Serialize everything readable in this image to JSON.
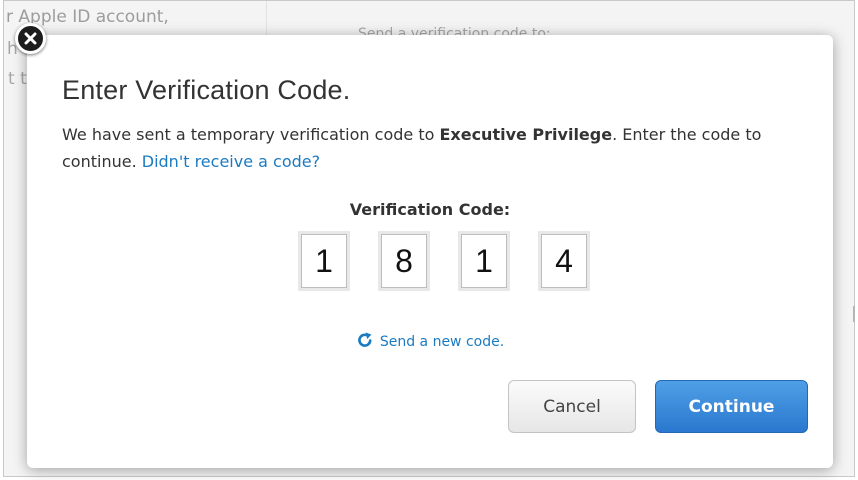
{
  "background": {
    "left_text": "r Apple ID account,",
    "fragment_1": "h",
    "fragment_2": "t t",
    "right_text": "Send a verification code to:"
  },
  "icons": {
    "close": "close-icon",
    "refresh": "refresh-icon"
  },
  "modal": {
    "title": "Enter Verification Code.",
    "message_prefix": "We have sent a temporary verification code to ",
    "message_recipient": "Executive Privilege",
    "message_suffix": ". Enter the code to continue. ",
    "didnt_receive_link": "Didn't receive a code?",
    "code_label": "Verification Code:",
    "code_digits": [
      "1",
      "8",
      "1",
      "4"
    ],
    "send_new_code": "Send a new code.",
    "cancel_label": "Cancel",
    "continue_label": "Continue"
  },
  "colors": {
    "accent": "#1b7bc1",
    "primary_button": "#2f7fd4",
    "text": "#333333"
  }
}
